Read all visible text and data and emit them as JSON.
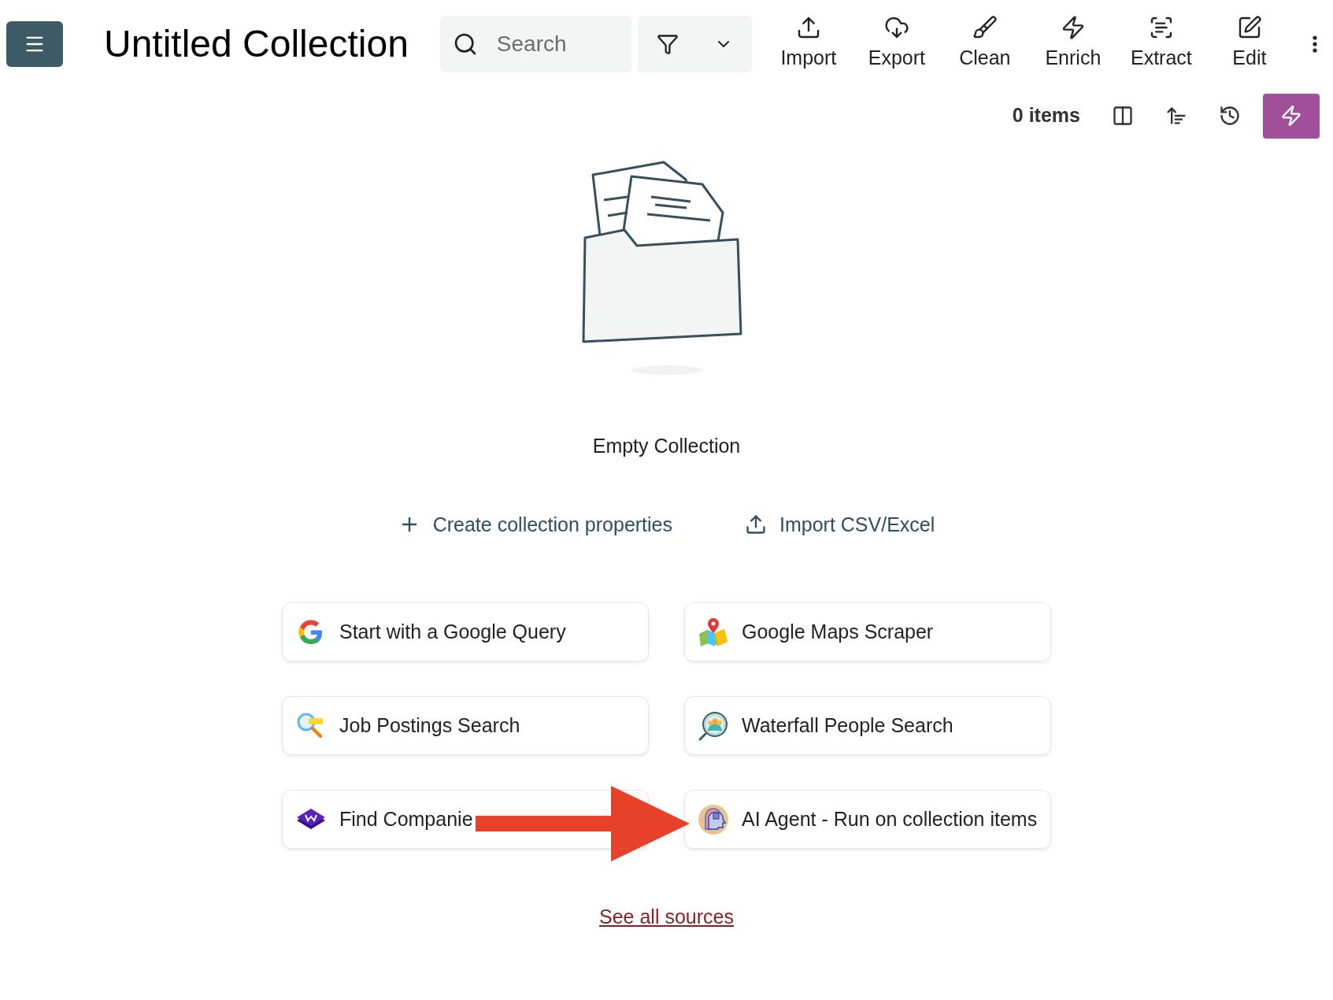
{
  "header": {
    "title": "Untitled Collection",
    "search": {
      "placeholder": "Search"
    },
    "toolbar": [
      {
        "kind": "import",
        "label": "Import"
      },
      {
        "kind": "export",
        "label": "Export"
      },
      {
        "kind": "clean",
        "label": "Clean"
      },
      {
        "kind": "enrich",
        "label": "Enrich"
      },
      {
        "kind": "extract",
        "label": "Extract"
      },
      {
        "kind": "edit",
        "label": "Edit"
      }
    ]
  },
  "subbar": {
    "count": "0 items"
  },
  "empty_state": {
    "message": "Empty Collection",
    "actions": [
      {
        "kind": "create",
        "label": "Create collection properties"
      },
      {
        "kind": "import",
        "label": "Import CSV/Excel"
      }
    ],
    "sources": [
      {
        "kind": "google",
        "label": "Start with a Google Query"
      },
      {
        "kind": "maps",
        "label": "Google Maps Scraper"
      },
      {
        "kind": "jobs",
        "label": "Job Postings Search"
      },
      {
        "kind": "people",
        "label": "Waterfall People Search"
      },
      {
        "kind": "tech",
        "label": "Find Companie"
      },
      {
        "kind": "agent",
        "label": "AI Agent - Run on collection items"
      }
    ],
    "link": "See all sources"
  }
}
